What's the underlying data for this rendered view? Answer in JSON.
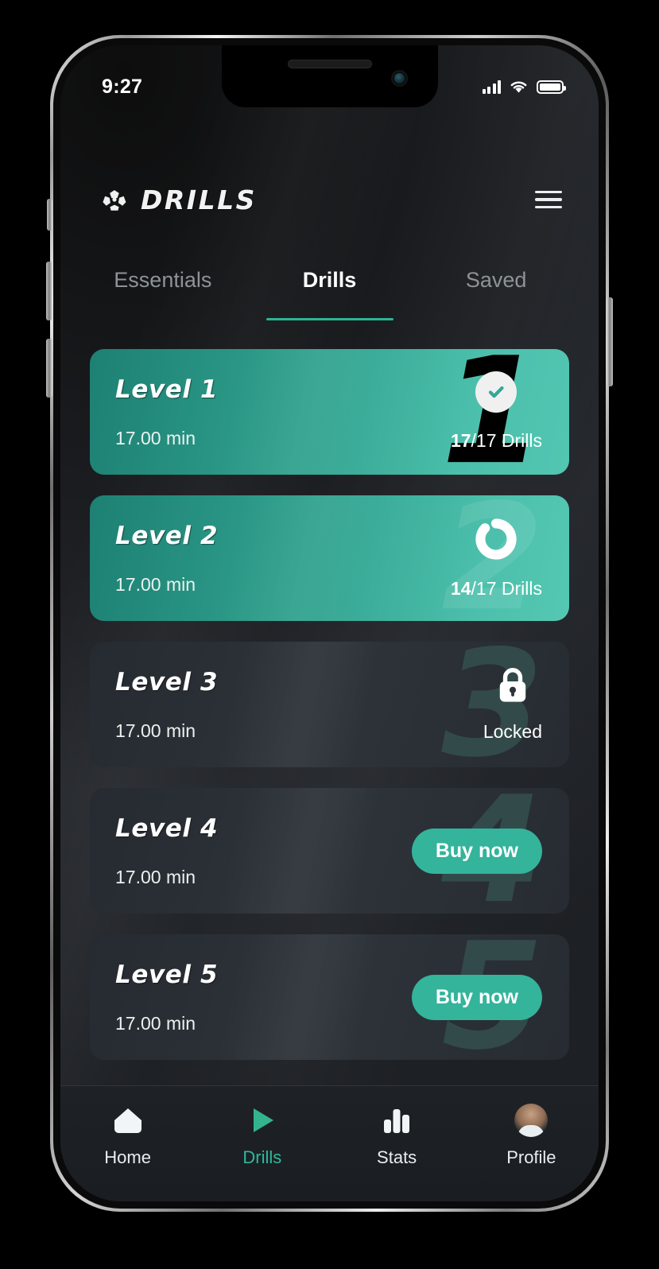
{
  "status_bar": {
    "time": "9:27",
    "signal_icon": "signal-bars-icon",
    "wifi_icon": "wifi-icon",
    "battery_icon": "battery-full-icon"
  },
  "header": {
    "logo_icon": "drills-ball-logo-icon",
    "brand": "DRILLS",
    "menu_icon": "hamburger-menu-icon"
  },
  "tabs": [
    {
      "label": "Essentials",
      "active": false
    },
    {
      "label": "Drills",
      "active": true
    },
    {
      "label": "Saved",
      "active": false
    }
  ],
  "theme": {
    "accent": "#2bb596",
    "card_teal_dark": "#1d8073",
    "card_teal_light": "#52c6b1",
    "card_dark": "#2d3339",
    "buy_button": "#33b49b",
    "text_primary": "#ffffff",
    "text_muted": "#8d9398"
  },
  "levels": [
    {
      "name": "Level 1",
      "duration": "17.00 min",
      "state": "completed",
      "status_icon": "check-circle-icon",
      "completed": "17",
      "total": "/17 Drills",
      "watermark": "1"
    },
    {
      "name": "Level 2",
      "duration": "17.00 min",
      "state": "in-progress",
      "status_icon": "progress-ring-icon",
      "completed": "14",
      "total": "/17 Drills",
      "progress_percent": 82,
      "watermark": "2"
    },
    {
      "name": "Level 3",
      "duration": "17.00 min",
      "state": "locked",
      "status_icon": "lock-icon",
      "status_label": "Locked",
      "watermark": "3"
    },
    {
      "name": "Level 4",
      "duration": "17.00 min",
      "state": "purchasable",
      "action_label": "Buy now",
      "watermark": "4"
    },
    {
      "name": "Level 5",
      "duration": "17.00 min",
      "state": "purchasable",
      "action_label": "Buy now",
      "watermark": "5"
    }
  ],
  "bottom_nav": [
    {
      "label": "Home",
      "icon": "home-icon",
      "active": false
    },
    {
      "label": "Drills",
      "icon": "play-icon",
      "active": true
    },
    {
      "label": "Stats",
      "icon": "bar-chart-icon",
      "active": false
    },
    {
      "label": "Profile",
      "icon": "avatar-icon",
      "active": false
    }
  ]
}
